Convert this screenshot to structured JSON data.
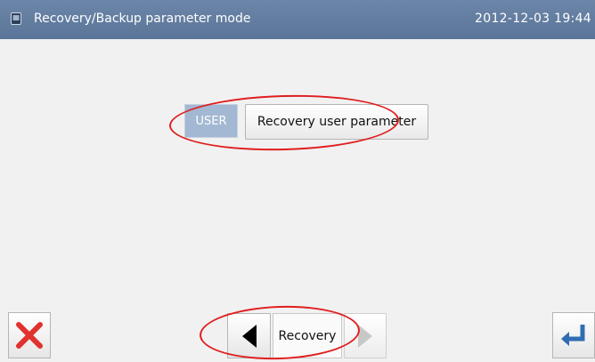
{
  "header": {
    "title": "Recovery/Backup parameter mode",
    "datetime": "2012-12-03  19:44",
    "icon": "screen-icon"
  },
  "main": {
    "user_badge": "USER",
    "param_button_label": "Recovery user parameter"
  },
  "footer": {
    "cancel_icon": "close-icon",
    "prev_icon": "arrow-left-icon",
    "mode_label": "Recovery",
    "next_icon": "arrow-right-icon",
    "enter_icon": "enter-icon"
  },
  "colors": {
    "titlebar": "#6c86a9",
    "user_badge": "#a3b8d2",
    "annotation": "#e01e1e",
    "cancel_x": "#e0322e",
    "enter_arrow": "#2f6db3"
  }
}
